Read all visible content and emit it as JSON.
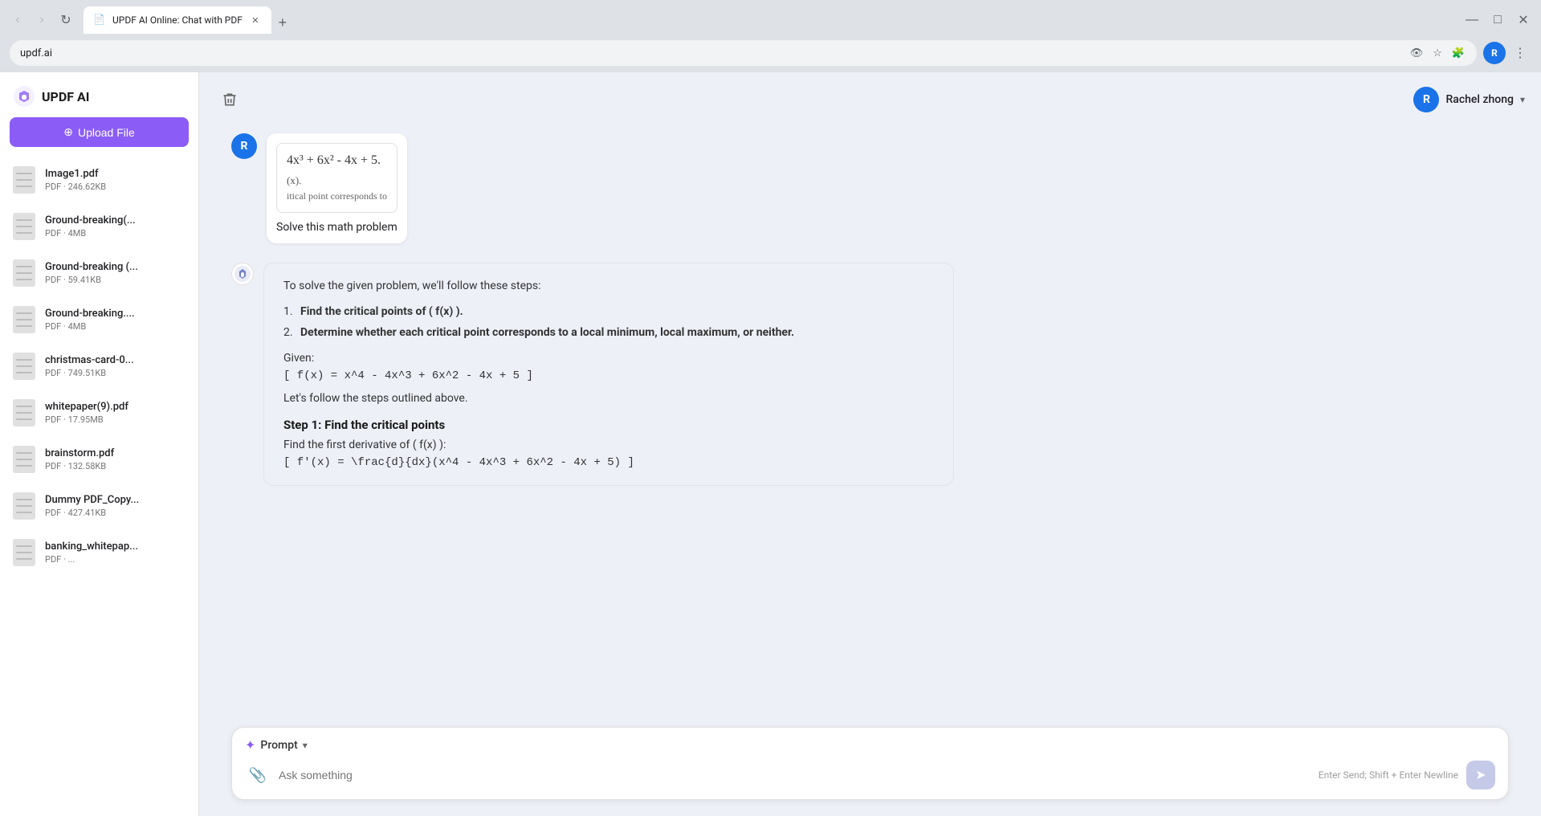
{
  "browser": {
    "tabs": [
      {
        "id": "tab-1",
        "title": "UPDF AI Online: Chat with PDF",
        "url": "updf.ai",
        "active": true,
        "favicon": "📄"
      }
    ],
    "address": "updf.ai",
    "window_controls": {
      "minimize": "—",
      "maximize": "□",
      "close": "✕"
    }
  },
  "sidebar": {
    "app_name": "UPDF AI",
    "upload_button": "Upload File",
    "files": [
      {
        "name": "Image1.pdf",
        "meta": "PDF · 246.62KB"
      },
      {
        "name": "Ground-breaking(...",
        "meta": "PDF · 4MB"
      },
      {
        "name": "Ground-breaking (...",
        "meta": "PDF · 59.41KB"
      },
      {
        "name": "Ground-breaking....",
        "meta": "PDF · 4MB"
      },
      {
        "name": "christmas-card-0...",
        "meta": "PDF · 749.51KB"
      },
      {
        "name": "whitepaper(9).pdf",
        "meta": "PDF · 17.95MB"
      },
      {
        "name": "brainstorm.pdf",
        "meta": "PDF · 132.58KB"
      },
      {
        "name": "Dummy PDF_Copy...",
        "meta": "PDF · 427.41KB"
      },
      {
        "name": "banking_whitepap...",
        "meta": "PDF · ..."
      }
    ]
  },
  "header": {
    "trash_label": "🗑",
    "user_name": "Rachel zhong",
    "user_initial": "R",
    "chevron": "▾"
  },
  "chat": {
    "user_avatar_initial": "R",
    "user_message": {
      "math_formula": "4x³ + 6x² - 4x + 5.",
      "math_sub": "(x).",
      "math_note": "itical point corresponds to",
      "text": "Solve this math problem"
    },
    "ai_response": {
      "intro": "To solve the given problem, we'll follow these steps:",
      "steps_list": [
        {
          "num": "1.",
          "text": "Find the critical points of ( f(x) )."
        },
        {
          "num": "2.",
          "text": "Determine whether each critical point corresponds to a local minimum, local maximum, or neither."
        }
      ],
      "given_label": "Given:",
      "given_formula": "[ f(x) = x^4 - 4x^3 + 6x^2 - 4x + 5 ]",
      "follow_text": "Let's follow the steps outlined above.",
      "step1_title": "Step 1: Find the critical points",
      "step1_text": "Find the first derivative of ( f(x) ):",
      "step1_formula": "[ f'(x) = \\frac{d}{dx}(x^4 - 4x^3 + 6x^2 - 4x + 5) ]"
    }
  },
  "input": {
    "prompt_label": "Prompt",
    "prompt_chevron": "▾",
    "placeholder": "Ask something",
    "hint": "Enter Send; Shift + Enter Newline",
    "send_icon": "➤"
  }
}
